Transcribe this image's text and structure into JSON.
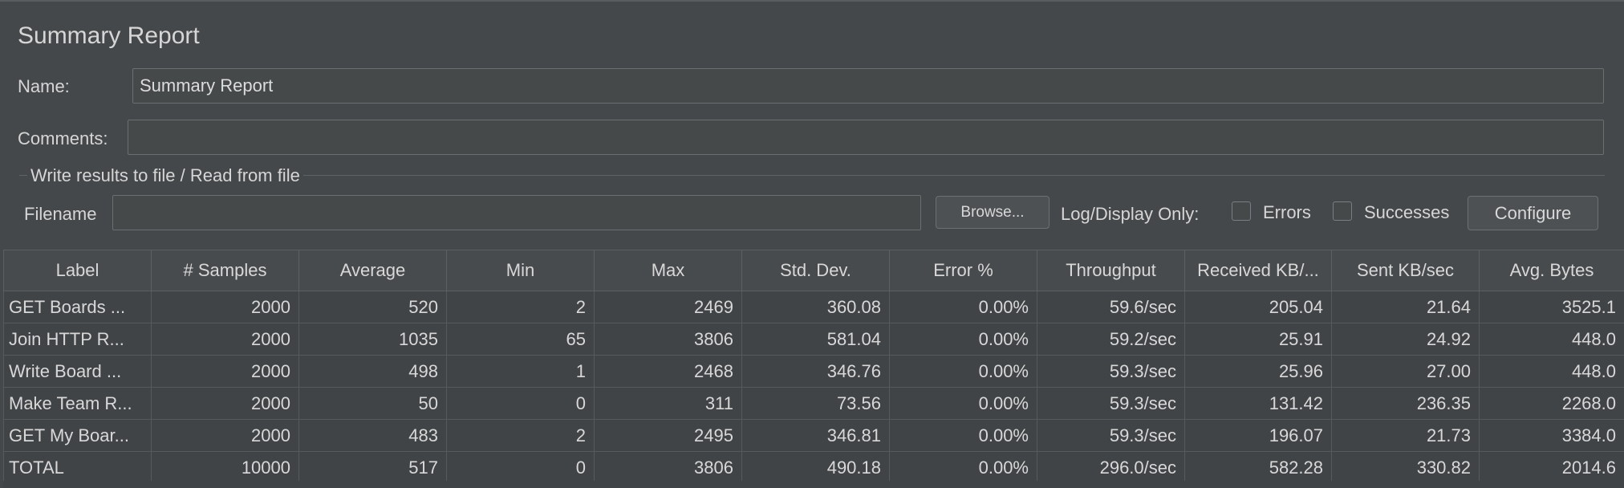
{
  "panel": {
    "title": "Summary Report",
    "name_label": "Name:",
    "name_value": "Summary Report",
    "comments_label": "Comments:",
    "comments_value": ""
  },
  "file_section": {
    "group_title": "Write results to file / Read from file",
    "filename_label": "Filename",
    "filename_value": "",
    "browse_label": "Browse...",
    "log_display_label": "Log/Display Only:",
    "errors_label": "Errors",
    "errors_checked": false,
    "successes_label": "Successes",
    "successes_checked": false,
    "configure_label": "Configure"
  },
  "table": {
    "columns": [
      "Label",
      "# Samples",
      "Average",
      "Min",
      "Max",
      "Std. Dev.",
      "Error %",
      "Throughput",
      "Received KB/...",
      "Sent KB/sec",
      "Avg. Bytes"
    ],
    "rows": [
      [
        "GET Boards ...",
        "2000",
        "520",
        "2",
        "2469",
        "360.08",
        "0.00%",
        "59.6/sec",
        "205.04",
        "21.64",
        "3525.1"
      ],
      [
        "Join HTTP R...",
        "2000",
        "1035",
        "65",
        "3806",
        "581.04",
        "0.00%",
        "59.2/sec",
        "25.91",
        "24.92",
        "448.0"
      ],
      [
        "Write Board ...",
        "2000",
        "498",
        "1",
        "2468",
        "346.76",
        "0.00%",
        "59.3/sec",
        "25.96",
        "27.00",
        "448.0"
      ],
      [
        "Make Team R...",
        "2000",
        "50",
        "0",
        "311",
        "73.56",
        "0.00%",
        "59.3/sec",
        "131.42",
        "236.35",
        "2268.0"
      ],
      [
        "GET My Boar...",
        "2000",
        "483",
        "2",
        "2495",
        "346.81",
        "0.00%",
        "59.3/sec",
        "196.07",
        "21.73",
        "3384.0"
      ],
      [
        "TOTAL",
        "10000",
        "517",
        "0",
        "3806",
        "490.18",
        "0.00%",
        "296.0/sec",
        "582.28",
        "330.82",
        "2014.6"
      ]
    ]
  },
  "colors": {
    "background": "#45484a",
    "text": "#d8d8d8",
    "field_border": "#6b6f72",
    "cell_background": "#414446"
  }
}
